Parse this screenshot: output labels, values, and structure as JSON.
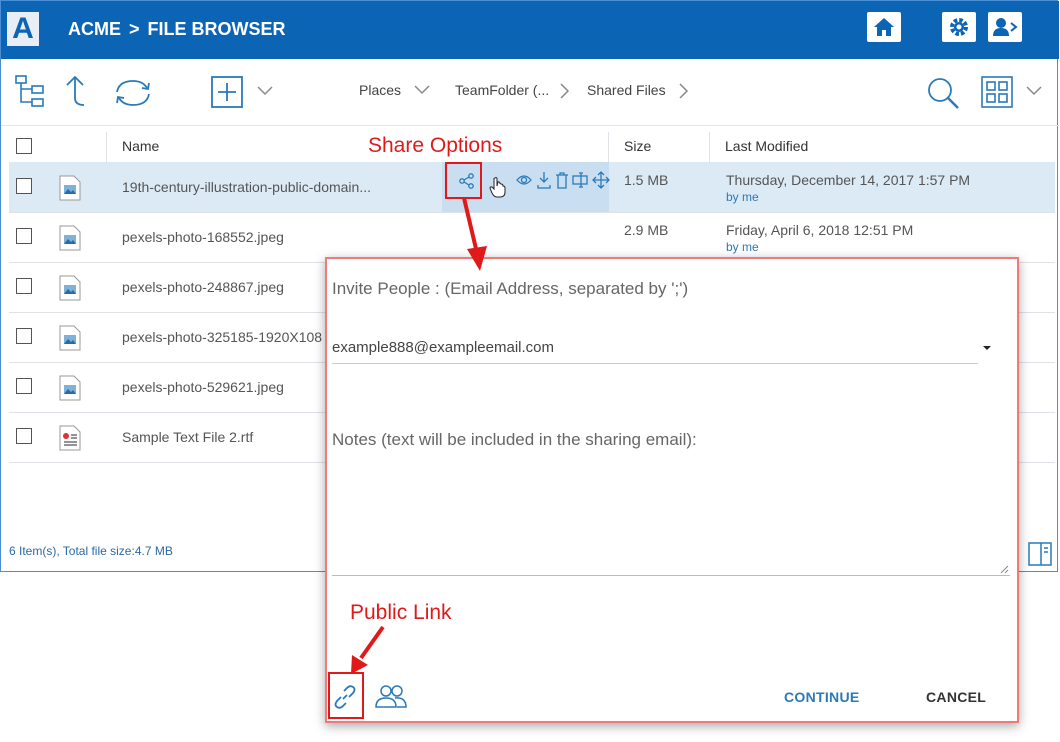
{
  "header": {
    "logo_letter": "A",
    "brand": "ACME",
    "separator": ">",
    "title": "FILE BROWSER",
    "buttons": [
      "home-icon",
      "gear-icon",
      "user-logout-icon"
    ],
    "color": "#0b64b4"
  },
  "toolbar": {
    "icons": [
      "tree-icon",
      "up-arrow-icon",
      "refresh-icon",
      "add-icon",
      "chevron-down-icon"
    ],
    "breadcrumb": [
      "Places",
      "TeamFolder (...",
      "Shared Files"
    ],
    "right_icons": [
      "search-icon",
      "grid-view-icon",
      "chevron-down-icon"
    ]
  },
  "table": {
    "columns": [
      "Name",
      "Size",
      "Last Modified"
    ],
    "rows": [
      {
        "name": "19th-century-illustration-public-domain...",
        "size": "1.5 MB",
        "date": "Thursday, December 14, 2017 1:57 PM",
        "by": "by me",
        "icon": "image-file-icon",
        "selected": true
      },
      {
        "name": "pexels-photo-168552.jpeg",
        "size": "2.9 MB",
        "date": "Friday, April 6, 2018 12:51 PM",
        "by": "by me",
        "icon": "image-file-icon"
      },
      {
        "name": "pexels-photo-248867.jpeg",
        "size": "",
        "date": "",
        "by": "",
        "icon": "image-file-icon"
      },
      {
        "name": "pexels-photo-325185-1920X108",
        "size": "",
        "date": "",
        "by": "",
        "icon": "image-file-icon"
      },
      {
        "name": "pexels-photo-529621.jpeg",
        "size": "",
        "date": "",
        "by": "",
        "icon": "image-file-icon"
      },
      {
        "name": "Sample Text File 2.rtf",
        "size": "",
        "date": "",
        "by": "",
        "icon": "text-file-icon"
      }
    ],
    "row_actions": [
      "share-icon",
      "preview-icon",
      "download-icon",
      "delete-icon",
      "rename-icon",
      "move-icon"
    ]
  },
  "footer": {
    "summary": "6 Item(s), Total file size:4.7 MB"
  },
  "dialog": {
    "invite_label": "Invite People : (Email Address, separated by ';')",
    "email_value": "example888@exampleemail.com",
    "notes_label": "Notes (text will be included in the sharing email):",
    "continue_label": "CONTINUE",
    "cancel_label": "CANCEL",
    "icons": [
      "link-icon",
      "people-icon"
    ]
  },
  "annotations": {
    "share_options": "Share Options",
    "public_link": "Public Link",
    "color": "#e01a1a"
  }
}
